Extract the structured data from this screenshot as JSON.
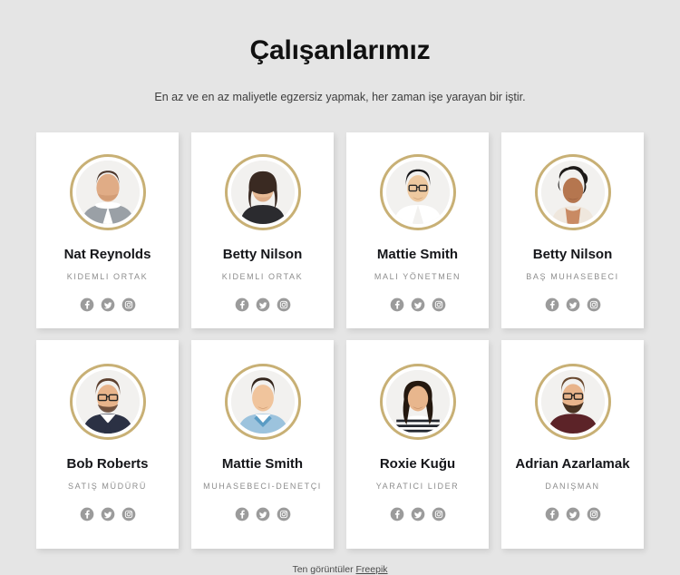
{
  "header": {
    "title": "Çalışanlarımız",
    "subtitle": "En az ve en az maliyetle egzersiz yapmak, her zaman işe yarayan bir iştir."
  },
  "colors": {
    "page_background": "#e5e5e5",
    "card_background": "#ffffff",
    "avatar_ring": "#c8b075",
    "name_text": "#15161a",
    "role_text": "#8d8d8d"
  },
  "social_icons": [
    {
      "name": "facebook-icon",
      "label": "Facebook"
    },
    {
      "name": "twitter-icon",
      "label": "Twitter"
    },
    {
      "name": "instagram-icon",
      "label": "Instagram"
    }
  ],
  "team": [
    {
      "name": "Nat Reynolds",
      "role": "KIDEMLI ORTAK"
    },
    {
      "name": "Betty Nilson",
      "role": "KIDEMLI ORTAK"
    },
    {
      "name": "Mattie Smith",
      "role": "MALI YÖNETMEN"
    },
    {
      "name": "Betty Nilson",
      "role": "BAŞ MUHASEBECI"
    },
    {
      "name": "Bob Roberts",
      "role": "SATIŞ MÜDÜRÜ"
    },
    {
      "name": "Mattie Smith",
      "role": "MUHASEBECI-DENETÇI"
    },
    {
      "name": "Roxie Kuğu",
      "role": "YARATICI LIDER"
    },
    {
      "name": "Adrian Azarlamak",
      "role": "DANIŞMAN"
    }
  ],
  "footer": {
    "credit_prefix": "Ten görüntüler",
    "credit_link": "Freepik"
  }
}
